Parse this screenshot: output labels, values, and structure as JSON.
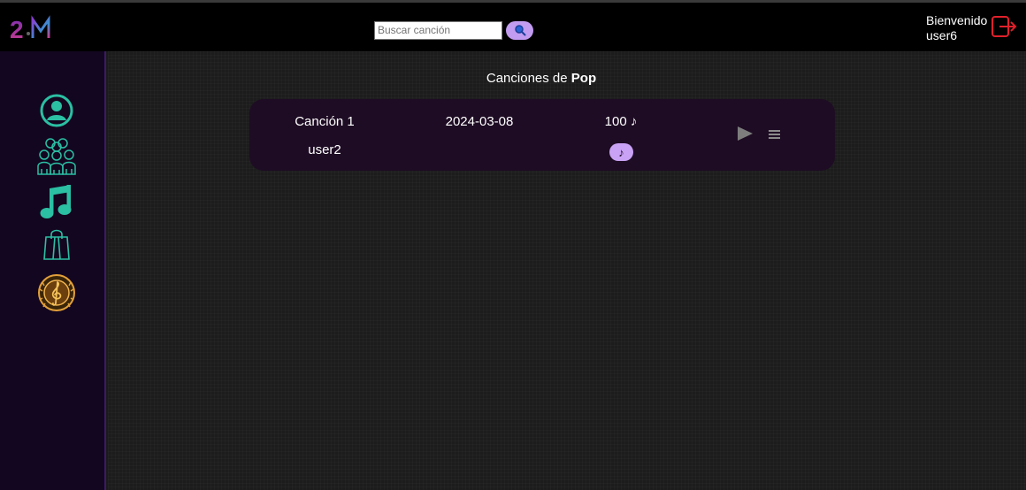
{
  "header": {
    "logo_text": "2M",
    "search": {
      "placeholder": "Buscar canción",
      "value": ""
    },
    "welcome_line1": "Bienvenido",
    "welcome_line2": "user6"
  },
  "sidebar": {
    "items": [
      {
        "icon": "user-icon",
        "color": "#2bbfa4"
      },
      {
        "icon": "group-icon",
        "color": "#2bbfa4"
      },
      {
        "icon": "music-note-icon",
        "color": "#2bbfa4"
      },
      {
        "icon": "shopping-bag-icon",
        "color": "#2bbfa4"
      },
      {
        "icon": "treble-clef-medal-icon",
        "color": "#d8902a"
      }
    ]
  },
  "main": {
    "title_prefix": "Canciones de",
    "genre": "Pop",
    "songs": [
      {
        "name": "Canción 1",
        "artist": "user2",
        "date": "2024-03-08",
        "plays": "100 ♪",
        "badge": "♪"
      }
    ]
  },
  "colors": {
    "accent": "#c29cf0",
    "sidebar_bg": "#130620",
    "card_bg": "#1e0c24",
    "logout": "#e0202a"
  }
}
